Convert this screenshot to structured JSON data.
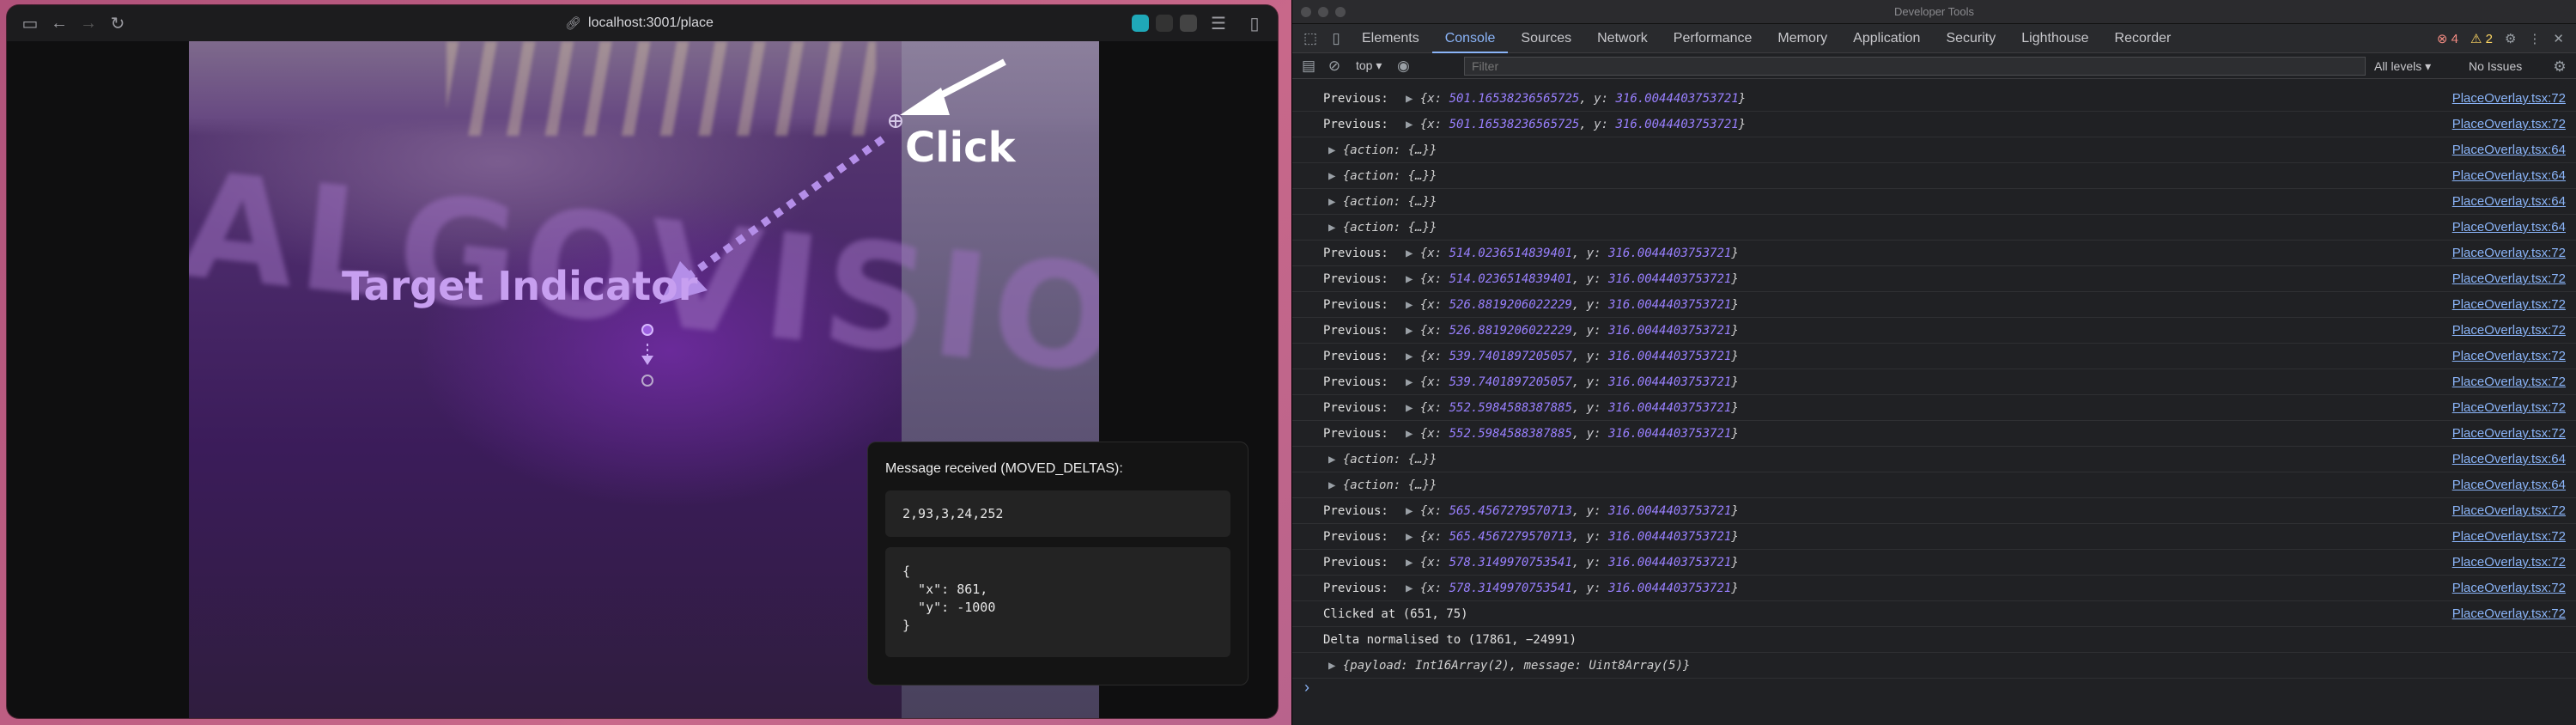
{
  "browser": {
    "url": "localhost:3001/place"
  },
  "stage": {
    "logo_text": "ALGOVISION",
    "target_label": "Target Indicator",
    "click_label": "Click"
  },
  "message": {
    "title": "Message received (MOVED_DELTAS):",
    "deltas": "2,93,3,24,252",
    "json": "{\n  \"x\": 861,\n  \"y\": -1000\n}"
  },
  "devtools": {
    "title": "Developer Tools",
    "tabs": [
      "Elements",
      "Console",
      "Sources",
      "Network",
      "Performance",
      "Memory",
      "Application",
      "Security",
      "Lighthouse",
      "Recorder"
    ],
    "active_tab": "Console",
    "errors": "4",
    "warnings": "2",
    "context": "top",
    "filter_placeholder": "Filter",
    "levels": "All levels",
    "issues": "No Issues"
  },
  "console": [
    {
      "label": "Previous:",
      "obj": {
        "x": "501.16538236565725",
        "y": "316.0044403753721"
      },
      "src": "PlaceOverlay.tsx:72"
    },
    {
      "label": "Previous:",
      "obj": {
        "x": "501.16538236565725",
        "y": "316.0044403753721"
      },
      "src": "PlaceOverlay.tsx:72"
    },
    {
      "action": "{action: {…}}",
      "src": "PlaceOverlay.tsx:64"
    },
    {
      "action": "{action: {…}}",
      "src": "PlaceOverlay.tsx:64"
    },
    {
      "action": "{action: {…}}",
      "src": "PlaceOverlay.tsx:64"
    },
    {
      "action": "{action: {…}}",
      "src": "PlaceOverlay.tsx:64"
    },
    {
      "label": "Previous:",
      "obj": {
        "x": "514.0236514839401",
        "y": "316.0044403753721"
      },
      "src": "PlaceOverlay.tsx:72"
    },
    {
      "label": "Previous:",
      "obj": {
        "x": "514.0236514839401",
        "y": "316.0044403753721"
      },
      "src": "PlaceOverlay.tsx:72"
    },
    {
      "label": "Previous:",
      "obj": {
        "x": "526.8819206022229",
        "y": "316.0044403753721"
      },
      "src": "PlaceOverlay.tsx:72"
    },
    {
      "label": "Previous:",
      "obj": {
        "x": "526.8819206022229",
        "y": "316.0044403753721"
      },
      "src": "PlaceOverlay.tsx:72"
    },
    {
      "label": "Previous:",
      "obj": {
        "x": "539.7401897205057",
        "y": "316.0044403753721"
      },
      "src": "PlaceOverlay.tsx:72"
    },
    {
      "label": "Previous:",
      "obj": {
        "x": "539.7401897205057",
        "y": "316.0044403753721"
      },
      "src": "PlaceOverlay.tsx:72"
    },
    {
      "label": "Previous:",
      "obj": {
        "x": "552.5984588387885",
        "y": "316.0044403753721"
      },
      "src": "PlaceOverlay.tsx:72"
    },
    {
      "label": "Previous:",
      "obj": {
        "x": "552.5984588387885",
        "y": "316.0044403753721"
      },
      "src": "PlaceOverlay.tsx:72"
    },
    {
      "action": "{action: {…}}",
      "src": "PlaceOverlay.tsx:64"
    },
    {
      "action": "{action: {…}}",
      "src": "PlaceOverlay.tsx:64"
    },
    {
      "label": "Previous:",
      "obj": {
        "x": "565.4567279570713",
        "y": "316.0044403753721"
      },
      "src": "PlaceOverlay.tsx:72"
    },
    {
      "label": "Previous:",
      "obj": {
        "x": "565.4567279570713",
        "y": "316.0044403753721"
      },
      "src": "PlaceOverlay.tsx:72"
    },
    {
      "label": "Previous:",
      "obj": {
        "x": "578.3149970753541",
        "y": "316.0044403753721"
      },
      "src": "PlaceOverlay.tsx:72"
    },
    {
      "label": "Previous:",
      "obj": {
        "x": "578.3149970753541",
        "y": "316.0044403753721"
      },
      "src": "PlaceOverlay.tsx:72"
    },
    {
      "text": "Clicked at (651, 75)",
      "src": "PlaceOverlay.tsx:72"
    },
    {
      "text": "Delta normalised to (17861, −24991)",
      "src": ""
    },
    {
      "action": "{payload: Int16Array(2), message: Uint8Array(5)}",
      "src": ""
    }
  ],
  "colors": {
    "accent": "#8ab4f8",
    "annotation_purple": "#b48ee8"
  }
}
